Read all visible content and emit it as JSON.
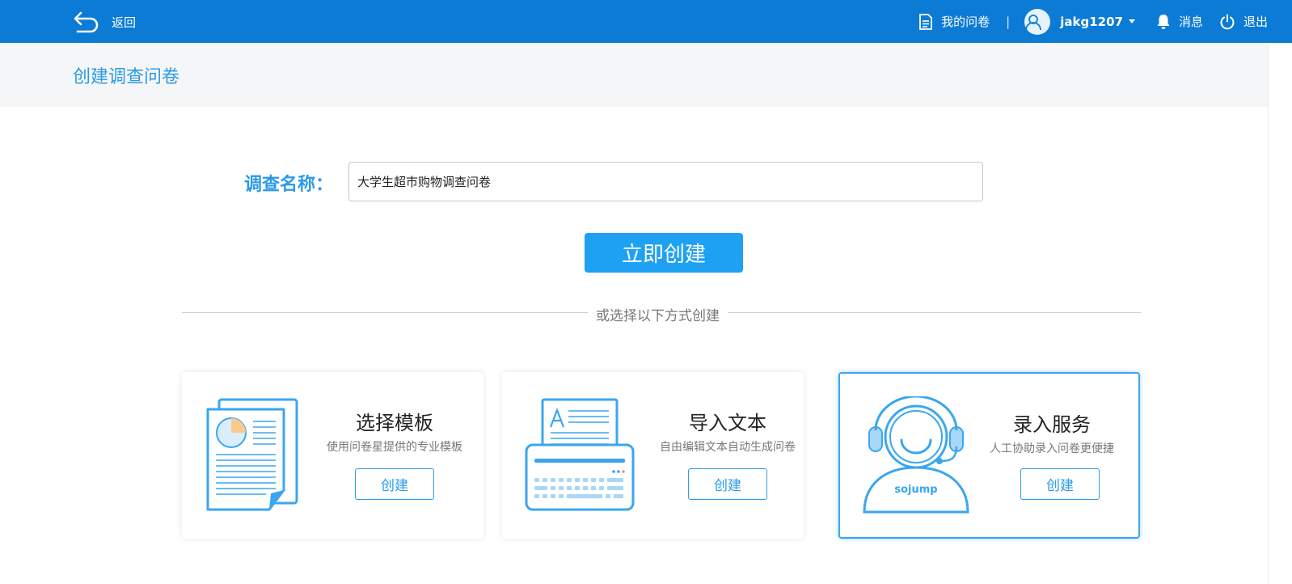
{
  "topbar": {
    "back_label": "返回",
    "my_surveys": "我的问卷",
    "separator": "|",
    "username": "jakg1207",
    "messages": "消息",
    "logout": "退出"
  },
  "subheader": {
    "title": "创建调查问卷"
  },
  "form": {
    "name_label": "调查名称：",
    "name_value": "大学生超市购物调查问卷",
    "create_button": "立即创建"
  },
  "divider_text": "或选择以下方式创建",
  "cards": [
    {
      "title": "选择模板",
      "desc": "使用问卷星提供的专业模板",
      "button": "创建",
      "icon": "template-document-icon"
    },
    {
      "title": "导入文本",
      "desc": "自由编辑文本自动生成问卷",
      "button": "创建",
      "icon": "typewriter-icon"
    },
    {
      "title": "录入服务",
      "desc": "人工协助录入问卷更便捷",
      "button": "创建",
      "icon": "support-agent-icon",
      "brand_text": "sojump"
    }
  ],
  "colors": {
    "topbar": "#0b7bd5",
    "accent": "#2b9ae8",
    "primary_button": "#1ea1f2",
    "icon_blue": "#3aa6f0",
    "icon_orange": "#f9c98e"
  }
}
